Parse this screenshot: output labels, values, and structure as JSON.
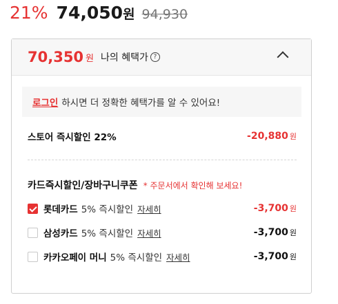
{
  "price": {
    "discount_rate": "21%",
    "sale_price": "74,050",
    "sale_unit": "원",
    "original_price": "94,930"
  },
  "benefit": {
    "price": "70,350",
    "unit": "원",
    "label": "나의 혜택가",
    "help_icon": "?"
  },
  "login": {
    "link": "로그인",
    "text": "하시면 더 정확한 혜택가를 알 수 있어요!"
  },
  "store_discount": {
    "label": "스토어 즉시할인 22%",
    "amount": "-20,880",
    "unit": "원"
  },
  "card_section": {
    "title": "카드즉시할인/장바구니쿠폰",
    "note": "* 주문서에서 확인해 보세요!",
    "cards": [
      {
        "name": "롯데카드",
        "desc": "5% 즉시할인",
        "detail": "자세히",
        "amount": "-3,700",
        "unit": "원",
        "checked": true
      },
      {
        "name": "삼성카드",
        "desc": "5% 즉시할인",
        "detail": "자세히",
        "amount": "-3,700",
        "unit": "원",
        "checked": false
      },
      {
        "name": "카카오페이 머니",
        "desc": "5% 즉시할인",
        "detail": "자세히",
        "amount": "-3,700",
        "unit": "원",
        "checked": false
      }
    ]
  },
  "colors": {
    "accent": "#e63232"
  },
  "icons": {
    "collapse": "chevron-up-icon",
    "help": "question-circle-icon",
    "check": "checkbox-icon"
  }
}
